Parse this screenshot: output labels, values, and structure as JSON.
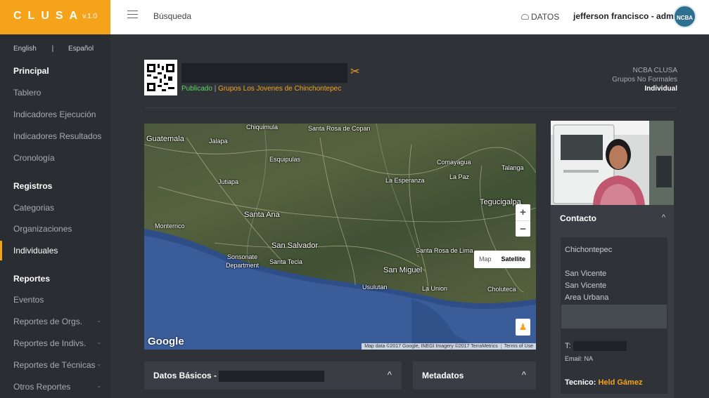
{
  "brand": {
    "logo": "CLUSA",
    "version": "v.1.0"
  },
  "header": {
    "search_label": "Búsqueda",
    "datos_label": "DATOS",
    "user_label": "jefferson francisco - admin",
    "avatar_text": "NCBA"
  },
  "sidebar": {
    "lang_en": "English",
    "lang_sep": "|",
    "lang_es": "Español",
    "principal": "Principal",
    "tablero": "Tablero",
    "ind_ejecucion": "Indicadores Ejecución",
    "ind_resultados": "Indicadores Resultados",
    "cronologia": "Cronología",
    "registros": "Registros",
    "categorias": "Categorias",
    "organizaciones": "Organizaciones",
    "individuales": "Individuales",
    "reportes": "Reportes",
    "eventos": "Eventos",
    "rep_orgs": "Reportes de Orgs.",
    "rep_indivs": "Reportes de Indivs.",
    "rep_tecnicas": "Reportes de Técnicas",
    "otros_reportes": "Otros Reportes",
    "chevron": "⌄"
  },
  "profile": {
    "status": "Publicado",
    "separator": " | ",
    "group": "Grupos Los Jovenes de Chinchontepec",
    "org": "NCBA CLUSA",
    "org_type": "Grupos No Formales",
    "kind": "Individual",
    "tools_icon": "✂"
  },
  "map": {
    "labels": {
      "guatemala": "Guatemala",
      "jalapa": "Jalapa",
      "esquipulas": "Esquipulas",
      "jutiapa": "Jutiapa",
      "santa_ana": "Santa Ana",
      "san_salvador": "San Salvador",
      "sonsonate": "Sonsonate",
      "department": "Department",
      "santa_tecla": "Santa Tecla",
      "san_miguel": "San Miguel",
      "usulutan": "Usulutan",
      "la_union": "La Union",
      "choluteca": "Choluteca",
      "tegucigalpa": "Tegucigalpa",
      "comayagua": "Comayagua",
      "la_esperanza": "La Esperanza",
      "la_paz": "La Paz",
      "talanga": "Talanga",
      "santa_rosa_copan": "Santa Rosa de Copan",
      "chiquimula": "Chiquimula",
      "monterrico": "Monterrico",
      "santa_rosa_lima": "Santa Rosa de Lima"
    },
    "zoom_in": "+",
    "zoom_out": "−",
    "type_map": "Map",
    "type_satellite": "Satellite",
    "google": "Google",
    "attribution": "Map data ©2017 Google, INEGI Imagery ©2017 TerraMetrics",
    "terms": "Terms of Use",
    "pegman_icon": "♟"
  },
  "panels": {
    "datos_basicos": "Datos Básicos -",
    "metadatos": "Metadatos",
    "caret": "^"
  },
  "contact": {
    "title": "Contacto",
    "caret": "^",
    "place": "Chichontepec",
    "dept": "San Vicente",
    "muni": "San Vicente",
    "area": "Area Urbana",
    "phone_label": "T:",
    "email": "Email: NA",
    "tecnico_label": "Tecnico:",
    "tecnico_name": "Held Gámez"
  }
}
